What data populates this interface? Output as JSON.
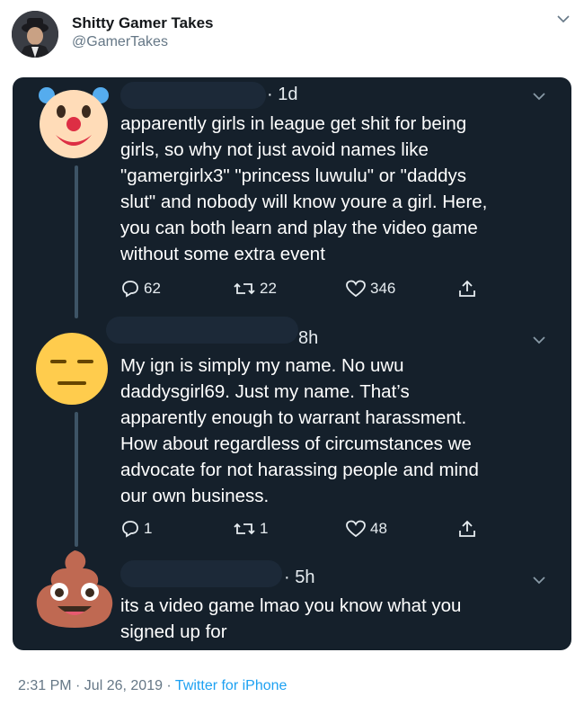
{
  "account": {
    "display_name": "Shitty Gamer Takes",
    "handle": "@GamerTakes"
  },
  "replies": [
    {
      "emoji": "clown-face",
      "time": "· 1d",
      "lines": [
        "apparently girls in league get shit for being",
        "girls, so why not just avoid names like",
        "\"gamergirlx3\" \"princess luwulu\" or \"daddys",
        "slut\" and nobody will know youre a girl. Here,",
        "you can both learn and play the video game",
        "without some extra event"
      ],
      "replies_count": "62",
      "retweets": "22",
      "likes": "346"
    },
    {
      "emoji": "expressionless-face",
      "time": "8h",
      "lines": [
        "My ign is simply my name. No uwu",
        "daddysgirl69. Just my name. That’s",
        "apparently enough to warrant harassment.",
        "How about regardless of circumstances we",
        "advocate for not harassing people and mind",
        "our own business."
      ],
      "replies_count": "1",
      "retweets": "1",
      "likes": "48"
    },
    {
      "emoji": "pile-of-poo",
      "time": "· 5h",
      "lines": [
        "its a video game lmao you know what you",
        "signed up for"
      ]
    }
  ],
  "footer": {
    "timestamp": "2:31 PM · Jul 26, 2019 · ",
    "source": "Twitter for iPhone"
  },
  "colors": {
    "screenshot_bg": "#15202b",
    "link": "#1da1f2",
    "muted": "#657786"
  }
}
